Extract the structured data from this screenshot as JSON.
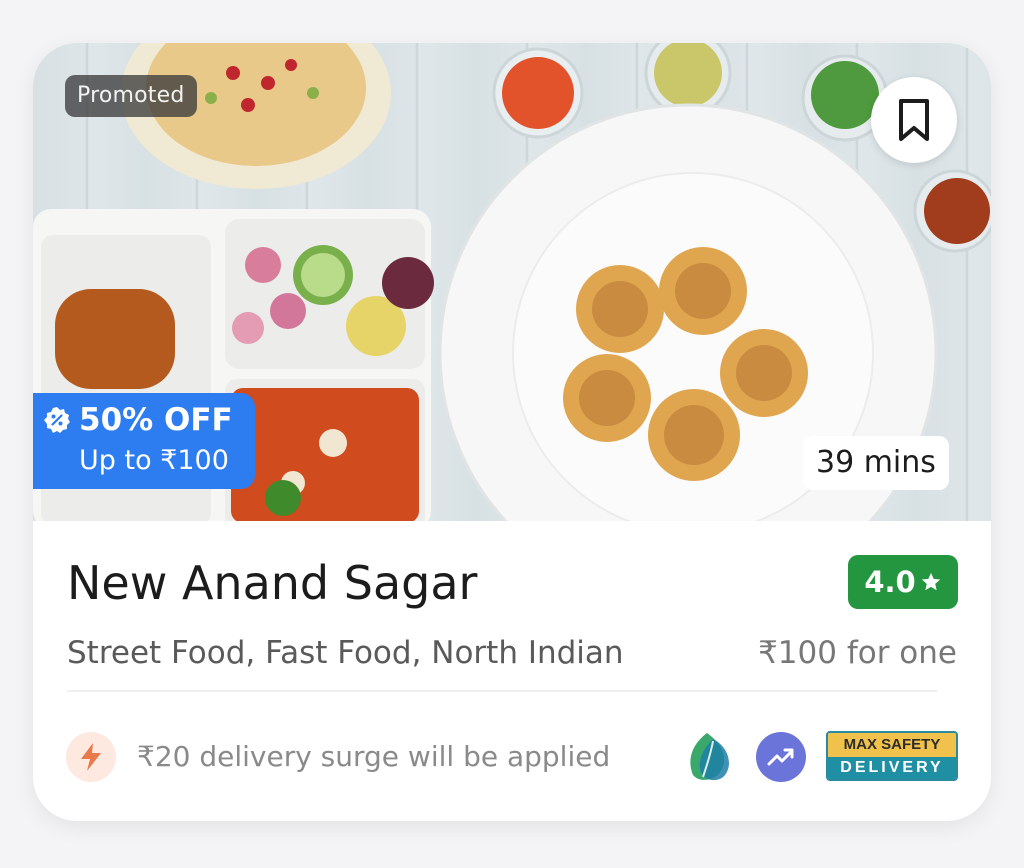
{
  "restaurant": {
    "promoted_label": "Promoted",
    "offer": {
      "title": "50% OFF",
      "subtitle": "Up to ₹100"
    },
    "eta": "39 mins",
    "name": "New Anand Sagar",
    "rating": "4.0",
    "cuisines": "Street Food, Fast Food, North Indian",
    "price_for_one": "₹100 for one",
    "surge_notice": "₹20 delivery surge will be applied"
  },
  "badges": {
    "max_safety_top": "MAX SAFETY",
    "max_safety_bottom": "DELIVERY"
  },
  "icons": {
    "bookmark": "bookmark-icon",
    "offer": "discount-badge-icon",
    "rating_star": "star-icon",
    "surge": "lightning-icon",
    "eco": "leaf-icon",
    "trending": "trending-up-icon"
  },
  "colors": {
    "offer_bg": "#2d7cf0",
    "rating_bg": "#24963f",
    "surge_icon_bg": "#fde9df",
    "trend_bg": "#6b74d8"
  }
}
